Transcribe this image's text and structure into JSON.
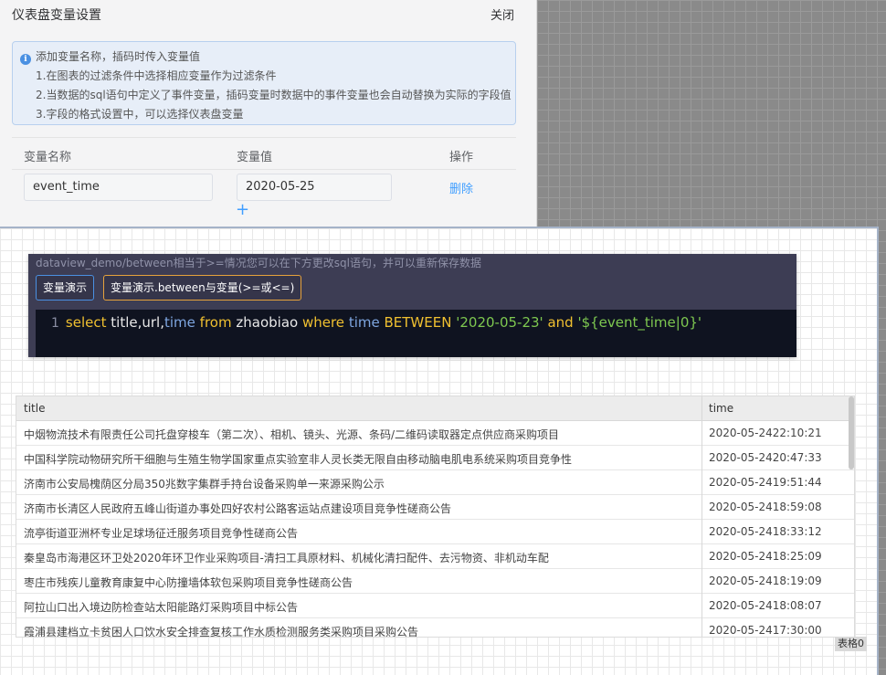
{
  "panel": {
    "title": "仪表盘变量设置",
    "close_label": "关闭",
    "info": {
      "icon": "info-icon",
      "heading": "添加变量名称，插码时传入变量值",
      "lines": [
        "1.在图表的过滤条件中选择相应变量作为过滤条件",
        "2.当数据的sql语句中定义了事件变量，插码变量时数据中的事件变量也会自动替换为实际的字段值",
        "3.字段的格式设置中，可以选择仪表盘变量"
      ]
    },
    "columns": [
      "变量名称",
      "变量值",
      "操作"
    ],
    "variables": [
      {
        "name": "event_time",
        "value": "2020-05-25",
        "action": "删除"
      }
    ],
    "add_label": "+"
  },
  "sql_card": {
    "hint": "dataview_demo/between相当于>=情况您可以在下方更改sql语句，并可以重新保存数据",
    "tabs": [
      "变量演示",
      "变量演示.between与变量(>=或<=)"
    ],
    "line_number": "1",
    "code": {
      "t1": "select",
      "t2": "title,url,",
      "t3": "time",
      "t4": "from",
      "t5": "zhaobiao",
      "t6": "where",
      "t7": "time",
      "t8": "BETWEEN",
      "t9": "'2020-05-23'",
      "t10": "and",
      "t11": "'${event_time|0}'"
    },
    "colors": {
      "keyword": "#f0c030",
      "string": "#7ec850",
      "function": "#7ea6e0"
    }
  },
  "table": {
    "columns": [
      "title",
      "time"
    ],
    "rows": [
      {
        "title": "中烟物流技术有限责任公司托盘穿梭车（第二次）、相机、镜头、光源、条码/二维码读取器定点供应商采购项目",
        "time": "2020-05-2422:10:21"
      },
      {
        "title": "中国科学院动物研究所干细胞与生殖生物学国家重点实验室非人灵长类无限自由移动脑电肌电系统采购项目竞争性",
        "time": "2020-05-2420:47:33"
      },
      {
        "title": "济南市公安局槐荫区分局350兆数字集群手持台设备采购单一来源采购公示",
        "time": "2020-05-2419:51:44"
      },
      {
        "title": "济南市长清区人民政府五峰山街道办事处四好农村公路客运站点建设项目竞争性磋商公告",
        "time": "2020-05-2418:59:08"
      },
      {
        "title": "流亭街道亚洲杯专业足球场征迁服务项目竞争性磋商公告",
        "time": "2020-05-2418:33:12"
      },
      {
        "title": "秦皇岛市海港区环卫处2020年环卫作业采购项目-清扫工具原材料、机械化清扫配件、去污物资、非机动车配",
        "time": "2020-05-2418:25:09"
      },
      {
        "title": "枣庄市残疾儿童教育康复中心防撞墙体软包采购项目竞争性磋商公告",
        "time": "2020-05-2418:19:09"
      },
      {
        "title": "阿拉山口出入境边防检查站太阳能路灯采购项目中标公告",
        "time": "2020-05-2418:08:07"
      },
      {
        "title": "霞浦县建档立卡贫困人口饮水安全排查复核工作水质检测服务类采购项目采购公告",
        "time": "2020-05-2417:30:00"
      }
    ],
    "tag": "表格0"
  }
}
